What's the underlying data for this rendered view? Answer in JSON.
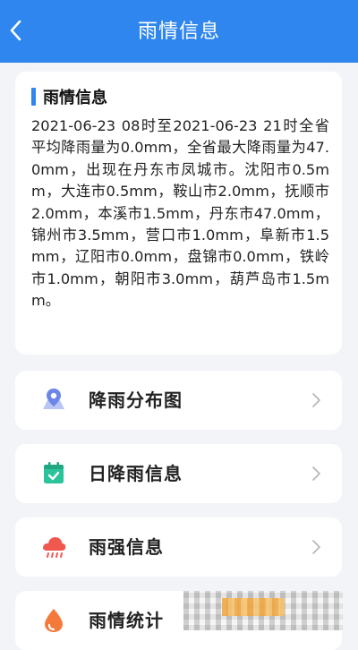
{
  "header": {
    "title": "雨情信息",
    "back_icon": "chevron-left-icon"
  },
  "info": {
    "title": "雨情信息",
    "text": "2021-06-23 08时至2021-06-23 21时全省平均降雨量为0.0mm，全省最大降雨量为47.0mm，出现在丹东市凤城市。沈阳市0.5mm，大连市0.5mm，鞍山市2.0mm，抚顺市2.0mm，本溪市1.5mm，丹东市47.0mm，锦州市3.5mm，营口市1.0mm，阜新市1.5mm，辽阳市0.0mm，盘锦市0.0mm，铁岭市1.0mm，朝阳市3.0mm，葫芦岛市1.5mm。"
  },
  "menu": {
    "items": [
      {
        "label": "降雨分布图",
        "icon": "map-pin-icon"
      },
      {
        "label": "日降雨信息",
        "icon": "calendar-check-icon"
      },
      {
        "label": "雨强信息",
        "icon": "rain-cloud-icon"
      },
      {
        "label": "雨情统计",
        "icon": "water-drop-icon"
      }
    ]
  },
  "colors": {
    "header_bg": "#2f86ee",
    "accent": "#2f86ee",
    "map_icon": "#6b86e8",
    "calendar_icon": "#2bc49a",
    "rain_icon": "#f0574f",
    "drop_icon": "#f47a3c"
  }
}
